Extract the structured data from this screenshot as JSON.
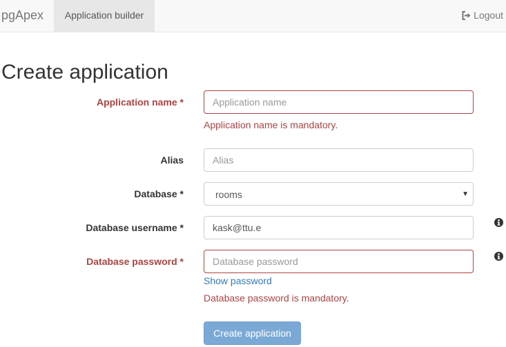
{
  "navbar": {
    "brand": "pgApex",
    "tab_builder": "Application builder",
    "logout": "Logout"
  },
  "page": {
    "title": "Create application"
  },
  "form": {
    "app_name": {
      "label": "Application name",
      "required_mark": "*",
      "value": "",
      "placeholder": "Application name",
      "error": "Application name is mandatory."
    },
    "alias": {
      "label": "Alias",
      "value": "",
      "placeholder": "Alias"
    },
    "database": {
      "label": "Database",
      "required_mark": "*",
      "selected": "rooms"
    },
    "db_username": {
      "label": "Database username",
      "required_mark": "*",
      "value": "kask@ttu.e",
      "info_icon": "info-circle-icon"
    },
    "db_password": {
      "label": "Database password",
      "required_mark": "*",
      "value": "",
      "placeholder": "Database password",
      "show_password": "Show password",
      "error": "Database password is mandatory.",
      "info_icon": "info-circle-icon"
    },
    "submit_label": "Create application"
  },
  "colors": {
    "error": "#a94442",
    "link": "#337ab7",
    "primary_disabled": "#7ba9d6",
    "navbar_bg": "#f8f8f8",
    "active_tab_bg": "#e7e7e7"
  }
}
